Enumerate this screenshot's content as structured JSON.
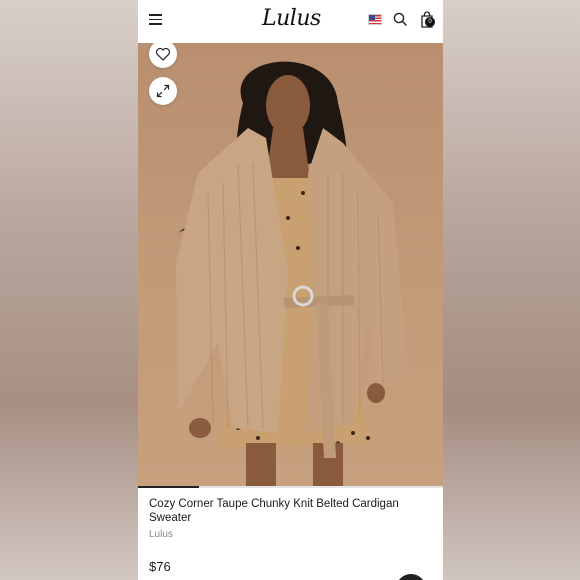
{
  "header": {
    "logo": "Lulus",
    "cart_count": "0",
    "icons": [
      "menu-icon",
      "flag-icon",
      "search-icon",
      "shopping-bag-icon"
    ]
  },
  "gallery": {
    "progress": 0.2,
    "buttons": [
      "heart-icon",
      "expand-icon"
    ]
  },
  "product": {
    "title": "Cozy Corner Taupe Chunky Knit Belted Cardigan Sweater",
    "brand": "Lulus",
    "price": "$76"
  },
  "colors": {
    "hero_bg": "#c29a78",
    "sweater": "#c8a583",
    "text": "#1a1a1a",
    "muted": "#888888"
  }
}
